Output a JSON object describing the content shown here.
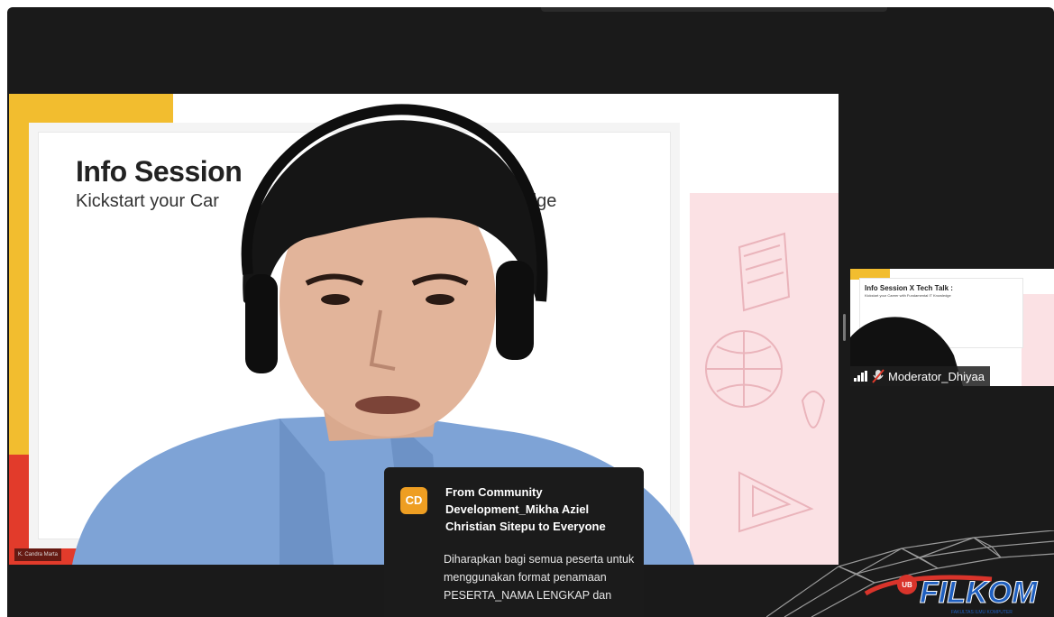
{
  "slide": {
    "title": "Info Session",
    "subtitle_left": "Kickstart your Car",
    "subtitle_right": "edge"
  },
  "main_video": {
    "name_tag": "K. Candra Marta"
  },
  "thumbnail": {
    "slide_title": "Info Session X Tech Talk :",
    "slide_subtitle": "Kickstart your Career with Fundamental IT Knowledge",
    "participant_name": "Moderator_Dhiyaa",
    "mic_status": "muted",
    "signal_icon": "signal-bars-icon"
  },
  "chat": {
    "avatar_initials": "CD",
    "sender": "From Community Development_Mikha Aziel Christian Sitepu to Everyone",
    "message": "Diharapkan bagi semua peserta untuk menggunakan format penamaan PESERTA_NAMA LENGKAP dan"
  },
  "logo": {
    "badge": "UB",
    "name": "FILKOM",
    "tagline": "FAKULTAS ILMU KOMPUTER"
  },
  "colors": {
    "app_bg": "#1a1a1a",
    "slide_yellow": "#f2bd2f",
    "slide_red": "#e23b2b",
    "slide_pink": "#fbe1e4",
    "avatar_orange": "#ee9e22",
    "logo_blue": "#1f5fbf",
    "logo_red": "#d9342b"
  }
}
